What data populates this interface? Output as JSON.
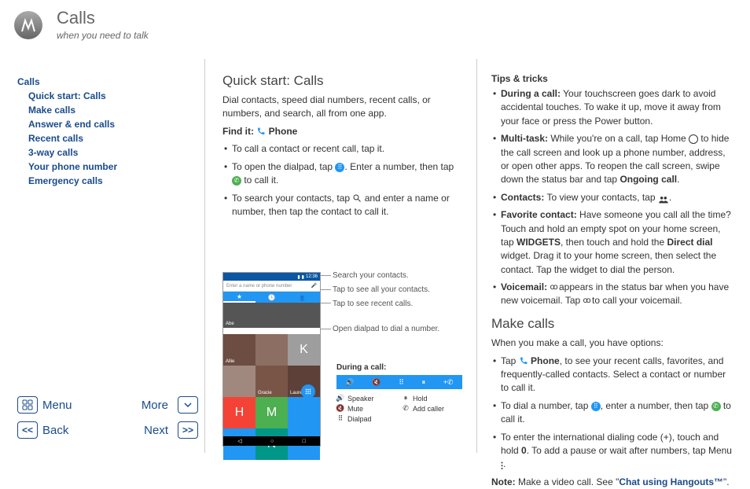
{
  "header": {
    "title": "Calls",
    "subtitle": "when you need to talk"
  },
  "toc": {
    "parent": "Calls",
    "items": [
      "Quick start: Calls",
      "Make calls",
      "Answer & end calls",
      "Recent calls",
      "3-way calls",
      "Your phone number",
      "Emergency calls"
    ]
  },
  "nav": {
    "menu": "Menu",
    "more": "More",
    "back": "Back",
    "next": "Next",
    "prev_sym": "<<",
    "next_sym": ">>"
  },
  "col1": {
    "h2": "Quick start: Calls",
    "intro": "Dial contacts, speed dial numbers, recent calls, or numbers, and search, all from one app.",
    "findit_label": "Find it:",
    "findit_value": "Phone",
    "bullets": {
      "b1": "To call a contact or recent call, tap it.",
      "b2a": "To open the dialpad, tap ",
      "b2b": ". Enter a number, then tap ",
      "b2c": " to call it.",
      "b3a": "To search your contacts, tap ",
      "b3b": " and enter a name or number, then tap the contact to call it."
    },
    "phone": {
      "time": "12:36",
      "search_placeholder": "Enter a name or phone number",
      "tile_wide_name": "Abe",
      "tiles": [
        {
          "label": "",
          "name": "Allie",
          "color": "#6d4c41"
        },
        {
          "label": "",
          "name": "",
          "color": "#8d6e63"
        },
        {
          "label": "K",
          "name": "",
          "color": "#9e9e9e"
        },
        {
          "label": "",
          "name": "",
          "color": "#a1887f"
        },
        {
          "label": "",
          "name": "Gracie",
          "color": "#795548"
        },
        {
          "label": "",
          "name": "Lauren",
          "color": "#5d4037"
        },
        {
          "label": "H",
          "name": "",
          "color": "#f44336"
        },
        {
          "label": "M",
          "name": "",
          "color": "#4caf50"
        },
        {
          "label": "",
          "name": "",
          "color": "#2196f3"
        },
        {
          "label": "",
          "name": "",
          "color": "#2196f3"
        },
        {
          "label": "N",
          "name": "",
          "color": "#009688"
        },
        {
          "label": "",
          "name": "",
          "color": "#2196f3"
        }
      ]
    },
    "callouts": {
      "c1": "Search your contacts.",
      "c2": "Tap to see all your contacts.",
      "c3": "Tap to see recent calls.",
      "c4": "Open dialpad to dial a number."
    },
    "callbar": {
      "title": "During a call:",
      "icons": {
        "speaker": "Speaker",
        "mute": "Mute",
        "dialpad": "Dialpad",
        "hold": "Hold",
        "add": "Add caller"
      }
    }
  },
  "col2": {
    "tips_h": "Tips & tricks",
    "tips": {
      "t1_b": "During a call:",
      "t1": " Your touchscreen goes dark to avoid accidental touches. To wake it up, move it away from your face or press the Power button.",
      "t2_b": "Multi-task:",
      "t2a": " While you're on a call, tap Home ",
      "t2b": " to hide the call screen and look up a phone number, address, or open other apps. To reopen the call screen, swipe down the status bar and tap ",
      "t2_ongoing": "Ongoing call",
      "t2c": ".",
      "t3_b": "Contacts:",
      "t3": " To view your contacts, tap ",
      "t4_b": "Favorite contact:",
      "t4a": " Have someone you call all the time? Touch and hold an empty spot on your home screen, tap ",
      "t4_widgets": "WIDGETS",
      "t4b": ", then touch and hold the ",
      "t4_dd": "Direct dial",
      "t4c": " widget. Drag it to your home screen, then select the contact. Tap the widget to dial the person.",
      "t5_b": "Voicemail:",
      "t5a": " ",
      "t5_vm1": "⚯",
      "t5b": " appears in the status bar when you have new voicemail. Tap ",
      "t5_vm2": "⚯",
      "t5c": " to call your voicemail."
    },
    "make_h": "Make calls",
    "make_intro": "When you make a call, you have options:",
    "make": {
      "m1a": "Tap ",
      "m1_phone": "Phone",
      "m1b": ", to see your recent calls, favorites, and frequently-called contacts. Select a contact or number to call it.",
      "m2a": "To dial a number, tap ",
      "m2b": ", enter a number, then tap ",
      "m2c": " to call it.",
      "m3a": "To enter the international dialing code (+), touch and hold ",
      "m3_zero": "0",
      "m3b": ". To add a pause or wait after numbers, tap Menu ",
      "m3c": "."
    },
    "note_b": "Note:",
    "note_a": " Make a video call. See \"",
    "note_link": "Chat using Hangouts™",
    "note_end": "\"."
  }
}
